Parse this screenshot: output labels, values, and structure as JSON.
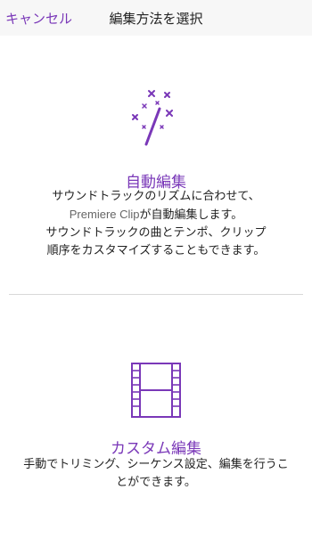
{
  "navbar": {
    "cancel_label": "キャンセル",
    "title": "編集方法を選択"
  },
  "auto_edit": {
    "icon": "magic-wand-icon",
    "title": "自動編集",
    "desc_line1": "サウンドトラックのリズムに合わせて、",
    "desc_line2_brand": "Premiere Clip",
    "desc_line2_rest": "が自動編集します。",
    "desc_line3": "サウンドトラックの曲とテンポ、クリップ",
    "desc_line4": "順序をカスタマイズすることもできます。"
  },
  "custom_edit": {
    "icon": "film-strip-icon",
    "title": "カスタム編集",
    "desc_line1": "手動でトリミング、シーケンス設定、編集を行うこ",
    "desc_line2": "とができます。"
  },
  "colors": {
    "accent": "#7a38b8",
    "navbar_bg": "#f7f7f7",
    "text": "#222222",
    "divider": "#d8d8d8"
  }
}
